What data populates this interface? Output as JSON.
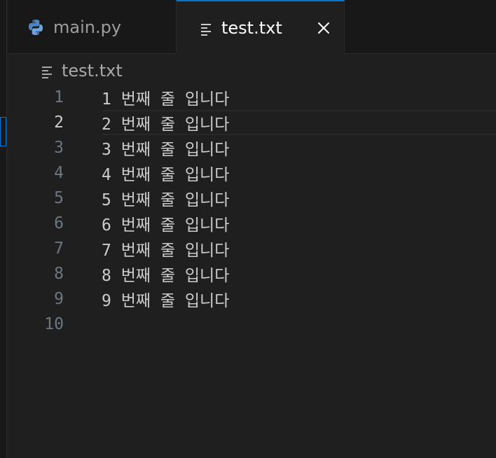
{
  "tabs": [
    {
      "label": "main.py",
      "icon": "python-icon",
      "active": false
    },
    {
      "label": "test.txt",
      "icon": "text-lines-icon",
      "active": true
    }
  ],
  "breadcrumb": {
    "label": "test.txt",
    "icon": "text-lines-icon"
  },
  "editor": {
    "current_line": 2,
    "lines": [
      {
        "number": "1",
        "text": "1 번째 줄 입니다"
      },
      {
        "number": "2",
        "text": "2 번째 줄 입니다"
      },
      {
        "number": "3",
        "text": "3 번째 줄 입니다"
      },
      {
        "number": "4",
        "text": "4 번째 줄 입니다"
      },
      {
        "number": "5",
        "text": "5 번째 줄 입니다"
      },
      {
        "number": "6",
        "text": "6 번째 줄 입니다"
      },
      {
        "number": "7",
        "text": "7 번째 줄 입니다"
      },
      {
        "number": "8",
        "text": "8 번째 줄 입니다"
      },
      {
        "number": "9",
        "text": "9 번째 줄 입니다"
      },
      {
        "number": "10",
        "text": ""
      }
    ]
  },
  "colors": {
    "accent": "#0078d4",
    "background": "#1f1f1f",
    "tabbar": "#181818",
    "python_blue": "#3572A5",
    "python_yellow": "#FFD43B"
  }
}
